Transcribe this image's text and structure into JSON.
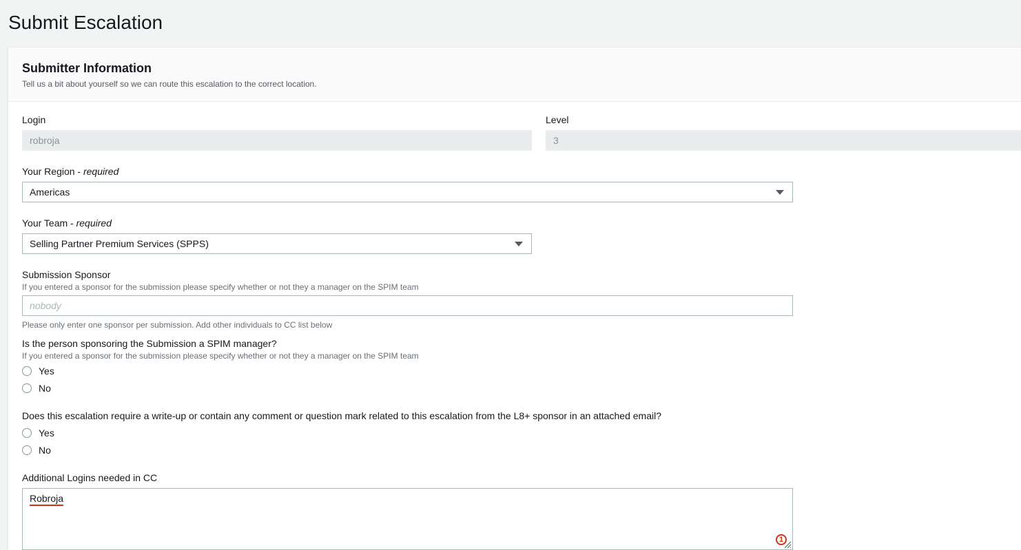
{
  "page": {
    "title": "Submit Escalation"
  },
  "section": {
    "title": "Submitter Information",
    "subtitle": "Tell us a bit about yourself so we can route this escalation to the correct location."
  },
  "login": {
    "label": "Login",
    "value": "robroja"
  },
  "level": {
    "label": "Level",
    "value": "3"
  },
  "region": {
    "label": "Your Region - ",
    "required": "required",
    "value": "Americas"
  },
  "team": {
    "label": "Your Team - ",
    "required": "required",
    "value": "Selling Partner Premium Services (SPPS)"
  },
  "sponsor": {
    "label": "Submission Sponsor",
    "description": "If you entered a sponsor for the submission please specify whether or not they a manager on the SPIM team",
    "placeholder": "nobody",
    "hint": "Please only enter one sponsor per submission. Add other individuals to CC list below"
  },
  "spim_question": {
    "label": "Is the person sponsoring the Submission a SPIM manager?",
    "description": "If you entered a sponsor for the submission please specify whether or not they a manager on the SPIM team",
    "options": [
      "Yes",
      "No"
    ]
  },
  "writeup_question": {
    "label": "Does this escalation require a write-up or contain any comment or question mark related to this escalation from the L8+ sponsor in an attached email?",
    "options": [
      "Yes",
      "No"
    ]
  },
  "cc": {
    "label": "Additional Logins needed in CC",
    "value": "Robroja",
    "spellcheck_count": "1"
  },
  "colors": {
    "background": "#f2f3f3",
    "readonly_field": "#eaeded",
    "error_accent": "#d13212"
  },
  "icons": [
    "dropdown-caret-icon",
    "spellcheck-badge-icon",
    "resize-handle-icon"
  ]
}
